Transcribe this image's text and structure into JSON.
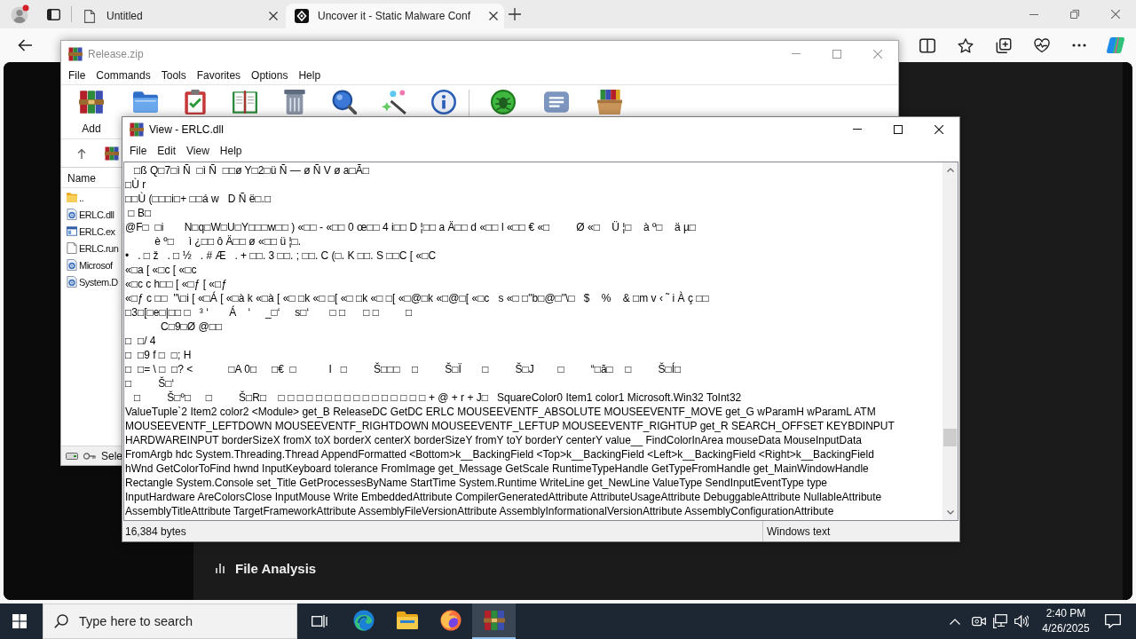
{
  "browser": {
    "tabs": [
      {
        "title": "Untitled",
        "selected": false
      },
      {
        "title": "Uncover it - Static Malware Conf",
        "selected": true
      }
    ]
  },
  "page": {
    "section_title": "File Analysis"
  },
  "archive_window": {
    "title": "Release.zip",
    "menu": [
      "File",
      "Commands",
      "Tools",
      "Favorites",
      "Options",
      "Help"
    ],
    "toolbar": [
      {
        "label": "Add"
      }
    ],
    "list_header": "Name",
    "files": [
      {
        "kind": "folder",
        "name": ".."
      },
      {
        "kind": "dll",
        "name": "ERLC.dll"
      },
      {
        "kind": "exe",
        "name": "ERLC.ex"
      },
      {
        "kind": "file",
        "name": "ERLC.run"
      },
      {
        "kind": "dll",
        "name": "Microsof"
      },
      {
        "kind": "dll",
        "name": "System.D"
      }
    ],
    "status": "Sele"
  },
  "viewer_window": {
    "title": "View - ERLC.dll",
    "menu": [
      "File",
      "Edit",
      "View",
      "Help"
    ],
    "lines": [
      "   □ß Q□7□ì Ñ  □ì Ñ  □□ø Y□2□ü Ñ — ø Ñ V ø a□Ã□",
      "□Ù r",
      "□□Ù (□□□i□+ □□á w   D Ñ ë□.□",
      " □ B□",
      "@F□  □i       N□q□W□U□Y□□□w□□ ) «□□ - «□□ 0 œ□□ 4 i□□ D ¦□□ a Ä□□ d «□□ l «□□ € «□         Ø «□    Ü ¦□    à º□    ä µ□",
      "          è º□     ì ¿□□ ô Ä□□ ø «□□ ü ¦□.",
      "•   . □ ž   . □ ½   . # Æ   . + □□. 3 □□. ; □□. C (□. K □□. S □□C [ «□C",
      "«□a [ «□c [ «□c",
      "«□c c h□□ [ «□ƒ [ «□ƒ",
      "«□ƒ c □□  \"\\□i [ «□Á [ «□à k «□à [ «□ □k «□ □[ «□ □k «□ □[ «□@□k «□@□[ «□c   s «□ □\"b□@□\"\\□   $    %    & □m v ‹ ˜ i À ç □□",
      "□3□[□e□|□□ □   ³ ‘       Á    ‘     _□‘     s□‘       □ □      □ □         □",
      "            C□9□Ø @□□",
      "□  □/ 4",
      "□  □9 f □  □; H",
      "□  □= \\ □  □? <            □A 0□     □€  □           I   □         Š□□□    □         Š□Ï       □         Š□J        □         “□ă□    □         Š□Í□",
      "□         Š□‘",
      "   □         Š□º□     □         Š□R□    □ □ □ □ □ □ □ □ □ □ □ □ □ □ □ □ + @ + r + J□   SquareColor0 Item1 color1 Microsoft.Win32 ToInt32",
      "ValueTuple`2 Item2 color2 <Module> get_B ReleaseDC GetDC ERLC MOUSEEVENTF_ABSOLUTE MOUSEEVENTF_MOVE get_G wParamH wParamL ATM",
      "MOUSEEVENTF_LEFTDOWN MOUSEEVENTF_RIGHTDOWN MOUSEEVENTF_LEFTUP MOUSEEVENTF_RIGHTUP get_R SEARCH_OFFSET KEYBDINPUT",
      "HARDWAREINPUT borderSizeX fromX toX borderX centerX borderSizeY fromY toY borderY centerY value__ FindColorInArea mouseData MouseInputData",
      "FromArgb hdc System.Threading.Thread AppendFormatted <Bottom>k__BackingField <Top>k__BackingField <Left>k__BackingField <Right>k__BackingField",
      "hWnd GetColorToFind hwnd InputKeyboard tolerance FromImage get_Message GetScale RuntimeTypeHandle GetTypeFromHandle get_MainWindowHandle",
      "Rectangle System.Console set_Title GetProcessesByName StartTime System.Runtime WriteLine get_NewLine ValueType SendInputEventType type",
      "InputHardware AreColorsClose InputMouse Write EmbeddedAttribute CompilerGeneratedAttribute AttributeUsageAttribute DebuggableAttribute NullableAttribute",
      "AssemblyTitleAttribute TargetFrameworkAttribute AssemblyFileVersionAttribute AssemblyInformationalVersionAttribute AssemblyConfigurationAttribute"
    ],
    "status_size": "16,384 bytes",
    "status_encoding": "Windows text"
  },
  "taskbar": {
    "search": {
      "placeholder": "Type here to search"
    },
    "apps": [
      {
        "selected": false
      },
      {
        "selected": false
      },
      {
        "selected": false
      },
      {
        "selected": true
      }
    ],
    "clock": {
      "time": "2:40 PM",
      "date": "4/26/2025"
    }
  }
}
